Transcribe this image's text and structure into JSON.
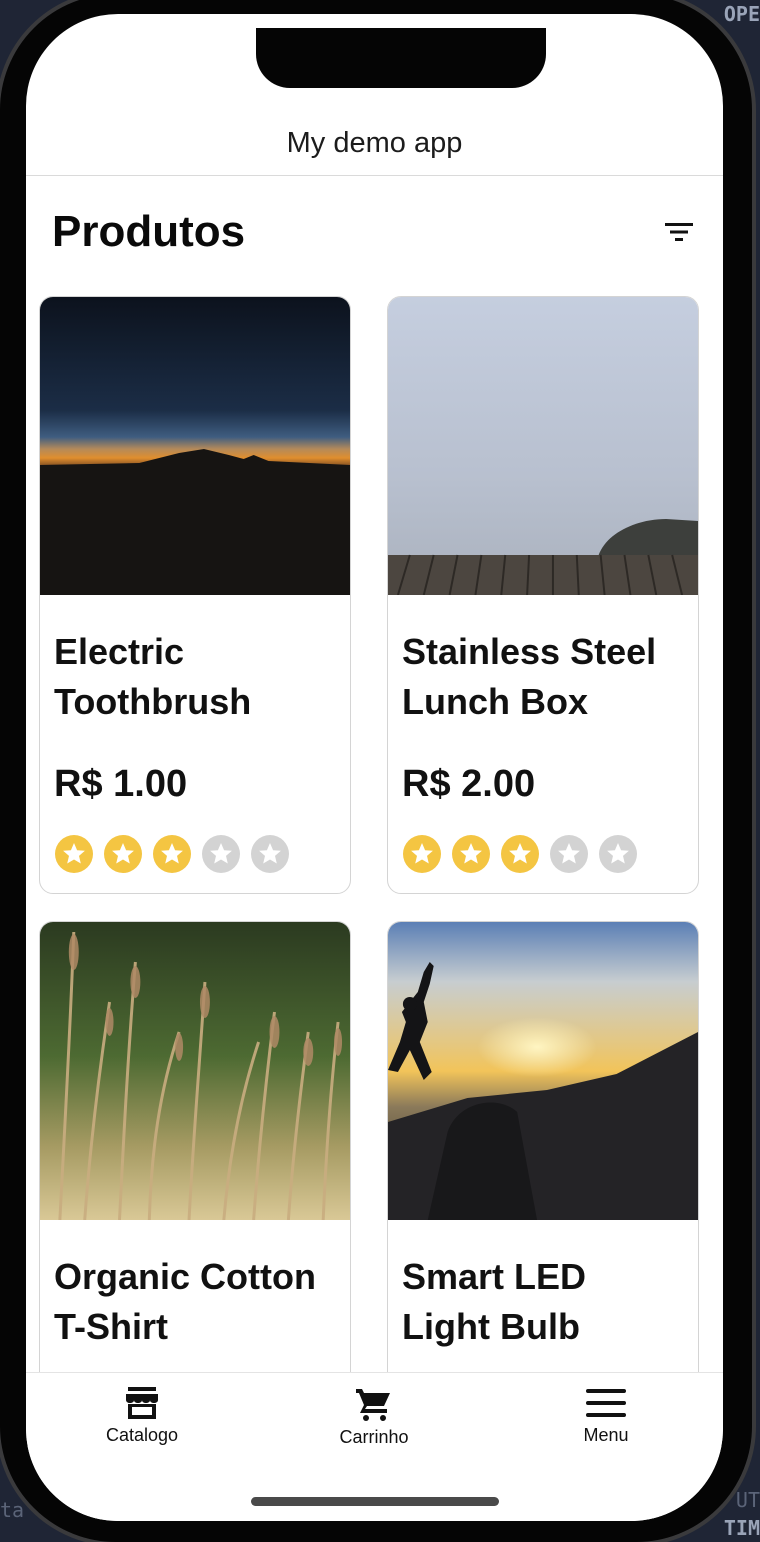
{
  "app": {
    "title": "My demo app"
  },
  "section": {
    "title": "Produtos",
    "filter_icon": "filter-icon"
  },
  "products": [
    {
      "name_line1": "Electric",
      "name_line2": "Toothbrush",
      "price": "R$ 1.00",
      "rating": 3,
      "max_rating": 5
    },
    {
      "name_line1": "Stainless Steel",
      "name_line2": "Lunch Box",
      "price": "R$ 2.00",
      "rating": 3,
      "max_rating": 5
    },
    {
      "name_line1": "Organic Cotton",
      "name_line2": "T-Shirt"
    },
    {
      "name_line1": "Smart LED",
      "name_line2": "Light Bulb"
    }
  ],
  "tabbar": {
    "items": [
      {
        "label": "Catalogo",
        "icon": "store-icon"
      },
      {
        "label": "Carrinho",
        "icon": "cart-icon"
      },
      {
        "label": "Menu",
        "icon": "menu-icon"
      }
    ]
  },
  "colors": {
    "star_filled": "#f4c542",
    "star_empty": "#d3d3d3"
  },
  "background": {
    "top_right": "OPE",
    "bottom_right": "TIM",
    "left_edge": "ta",
    "right_edge": "UT"
  }
}
